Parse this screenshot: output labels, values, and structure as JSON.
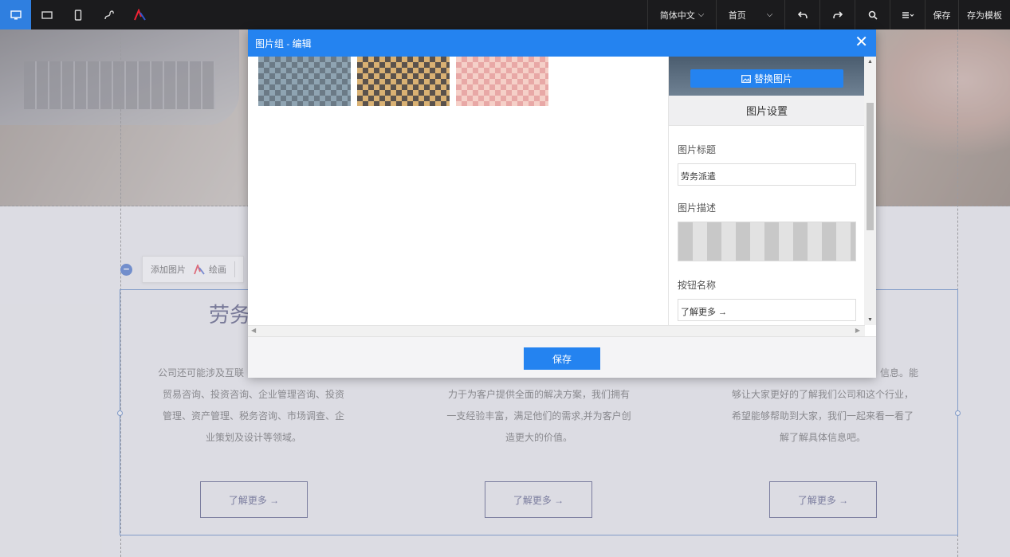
{
  "toolbar": {
    "language": "简体中文",
    "page_select": "首页",
    "save": "保存",
    "save_template": "存为模板"
  },
  "page": {
    "mini_toolbar": {
      "add_image": "添加图片",
      "draw": "绘画"
    },
    "section_title": "劳务",
    "columns": [
      {
        "text_lines": [
          "公司还可能涉及互联",
          "贸易咨询、投资咨询、企业管理咨询、投资",
          "管理、资产管理、税务咨询、市场调查、企",
          "业策划及设计等领域。"
        ],
        "button": "了解更多 →"
      },
      {
        "text_lines": [
          "",
          "力于为客户提供全面的解决方案，我们拥有",
          "一支经验丰富，满足他们的需求,并为客户创",
          "造更大的价值。"
        ],
        "button": "了解更多 →"
      },
      {
        "text_lines": [
          "信息。能",
          "够让大家更好的了解我们公司和这个行业，",
          "希望能够帮助到大家，我们一起来看一看了",
          "解了解具体信息吧。"
        ],
        "button": "了解更多 →"
      }
    ]
  },
  "modal": {
    "title": "图片组 - 编辑",
    "replace_image": "替换图片",
    "settings_tab": "图片设置",
    "fields": {
      "title_label": "图片标题",
      "title_value": "劳务派遣",
      "desc_label": "图片描述",
      "button_label": "按钮名称",
      "button_value": "了解更多 →"
    },
    "save": "保存"
  }
}
